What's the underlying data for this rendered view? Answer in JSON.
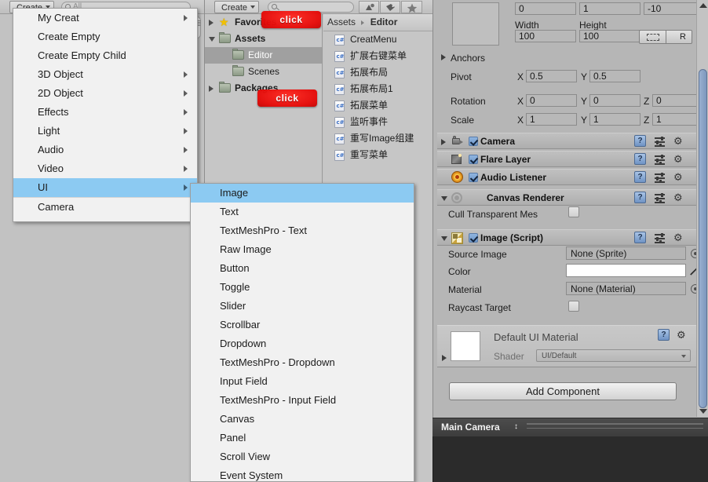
{
  "hierarchy": {
    "create_label": "Create",
    "search_placeholder": "All",
    "search_icon": "search-icon"
  },
  "project": {
    "create_label": "Create",
    "search_placeholder": "",
    "filter_icons": [
      "type-filter-icon",
      "label-filter-icon",
      "favorites-star-icon"
    ],
    "tree": [
      {
        "label": "Favorites",
        "indent": 0,
        "arrow": "collapsed",
        "icon": "star-icon",
        "bold": true,
        "selected": false
      },
      {
        "label": "Assets",
        "indent": 0,
        "arrow": "expanded",
        "icon": "folder-icon",
        "bold": true,
        "selected": false
      },
      {
        "label": "Editor",
        "indent": 1,
        "arrow": "none",
        "icon": "folder-icon",
        "bold": false,
        "selected": true
      },
      {
        "label": "Scenes",
        "indent": 1,
        "arrow": "none",
        "icon": "folder-icon",
        "bold": false,
        "selected": false
      },
      {
        "label": "Packages",
        "indent": 0,
        "arrow": "collapsed",
        "icon": "folder-icon",
        "bold": true,
        "selected": false
      }
    ],
    "breadcrumb": {
      "root": "Assets",
      "current": "Editor"
    },
    "assets": [
      {
        "name": "CreatMenu",
        "icon": "csharp-script-icon"
      },
      {
        "name": "扩展右键菜单",
        "icon": "csharp-script-icon"
      },
      {
        "name": "拓展布局",
        "icon": "csharp-script-icon"
      },
      {
        "name": "拓展布局1",
        "icon": "csharp-script-icon"
      },
      {
        "name": "拓展菜单",
        "icon": "csharp-script-icon"
      },
      {
        "name": "监听事件",
        "icon": "csharp-script-icon"
      },
      {
        "name": "重写Image组建",
        "icon": "csharp-script-icon"
      },
      {
        "name": "重写菜单",
        "icon": "csharp-script-icon"
      }
    ]
  },
  "annotations": {
    "badge_text": "click",
    "badge_color": "#e60a08"
  },
  "inspector": {
    "rect_transform": {
      "pos_x": "0",
      "pos_y": "1",
      "pos_z": "-10",
      "width_label": "Width",
      "height_label": "Height",
      "width": "100",
      "height": "100",
      "blueprint_label": "R",
      "anchors_label": "Anchors",
      "pivot_label": "Pivot",
      "pivot_x": "0.5",
      "pivot_y": "0.5",
      "rotation_label": "Rotation",
      "rot_x": "0",
      "rot_y": "0",
      "rot_z": "0",
      "scale_label": "Scale",
      "scale_x": "1",
      "scale_y": "1",
      "scale_z": "1",
      "axis_x": "X",
      "axis_y": "Y",
      "axis_z": "Z"
    },
    "components": [
      {
        "name": "Camera",
        "icon": "camera-icon",
        "checked": true,
        "expand": "collapsed"
      },
      {
        "name": "Flare Layer",
        "icon": "flare-layer-icon",
        "checked": true,
        "expand": "none"
      },
      {
        "name": "Audio Listener",
        "icon": "audio-listener-icon",
        "checked": true,
        "expand": "none"
      },
      {
        "name": "Canvas Renderer",
        "icon": "canvas-renderer-icon",
        "checked": false,
        "expand": "expanded"
      },
      {
        "name": "Image (Script)",
        "icon": "image-script-icon",
        "checked": true,
        "expand": "expanded"
      }
    ],
    "canvas_renderer": {
      "cull_label": "Cull Transparent Mes",
      "cull_checked": false
    },
    "image_script": {
      "source_image_label": "Source Image",
      "source_image_value": "None (Sprite)",
      "color_label": "Color",
      "color_value": "#ffffff",
      "material_label": "Material",
      "material_value": "None (Material)",
      "raycast_label": "Raycast Target",
      "raycast_checked": false,
      "eyedropper_icon": "eyedropper-icon"
    },
    "material_block": {
      "name": "Default UI Material",
      "shader_label": "Shader",
      "shader_value": "UI/Default"
    },
    "add_component_label": "Add Component",
    "preview": {
      "title": "Main Camera",
      "updown_icon": "up-down-arrows-icon"
    }
  },
  "create_menu": {
    "items": [
      {
        "label": "My Creat",
        "submenu": true,
        "highlighted": false,
        "separator_after": false
      },
      {
        "label": "Create Empty",
        "submenu": false,
        "highlighted": false,
        "separator_after": false
      },
      {
        "label": "Create Empty Child",
        "submenu": false,
        "highlighted": false,
        "separator_after": false
      },
      {
        "label": "3D Object",
        "submenu": true,
        "highlighted": false,
        "separator_after": false
      },
      {
        "label": "2D Object",
        "submenu": true,
        "highlighted": false,
        "separator_after": false
      },
      {
        "label": "Effects",
        "submenu": true,
        "highlighted": false,
        "separator_after": false
      },
      {
        "label": "Light",
        "submenu": true,
        "highlighted": false,
        "separator_after": false
      },
      {
        "label": "Audio",
        "submenu": true,
        "highlighted": false,
        "separator_after": false
      },
      {
        "label": "Video",
        "submenu": true,
        "highlighted": false,
        "separator_after": false
      },
      {
        "label": "UI",
        "submenu": true,
        "highlighted": true,
        "separator_after": true
      },
      {
        "label": "Camera",
        "submenu": false,
        "highlighted": false,
        "separator_after": false
      }
    ]
  },
  "ui_submenu": {
    "items": [
      {
        "label": "Image",
        "highlighted": true
      },
      {
        "label": "Text",
        "highlighted": false
      },
      {
        "label": "TextMeshPro - Text",
        "highlighted": false
      },
      {
        "label": "Raw Image",
        "highlighted": false
      },
      {
        "label": "Button",
        "highlighted": false
      },
      {
        "label": "Toggle",
        "highlighted": false
      },
      {
        "label": "Slider",
        "highlighted": false
      },
      {
        "label": "Scrollbar",
        "highlighted": false
      },
      {
        "label": "Dropdown",
        "highlighted": false
      },
      {
        "label": "TextMeshPro - Dropdown",
        "highlighted": false
      },
      {
        "label": "Input Field",
        "highlighted": false
      },
      {
        "label": "TextMeshPro - Input Field",
        "highlighted": false
      },
      {
        "label": "Canvas",
        "highlighted": false
      },
      {
        "label": "Panel",
        "highlighted": false
      },
      {
        "label": "Scroll View",
        "highlighted": false
      },
      {
        "label": "Event System",
        "highlighted": false
      }
    ]
  }
}
